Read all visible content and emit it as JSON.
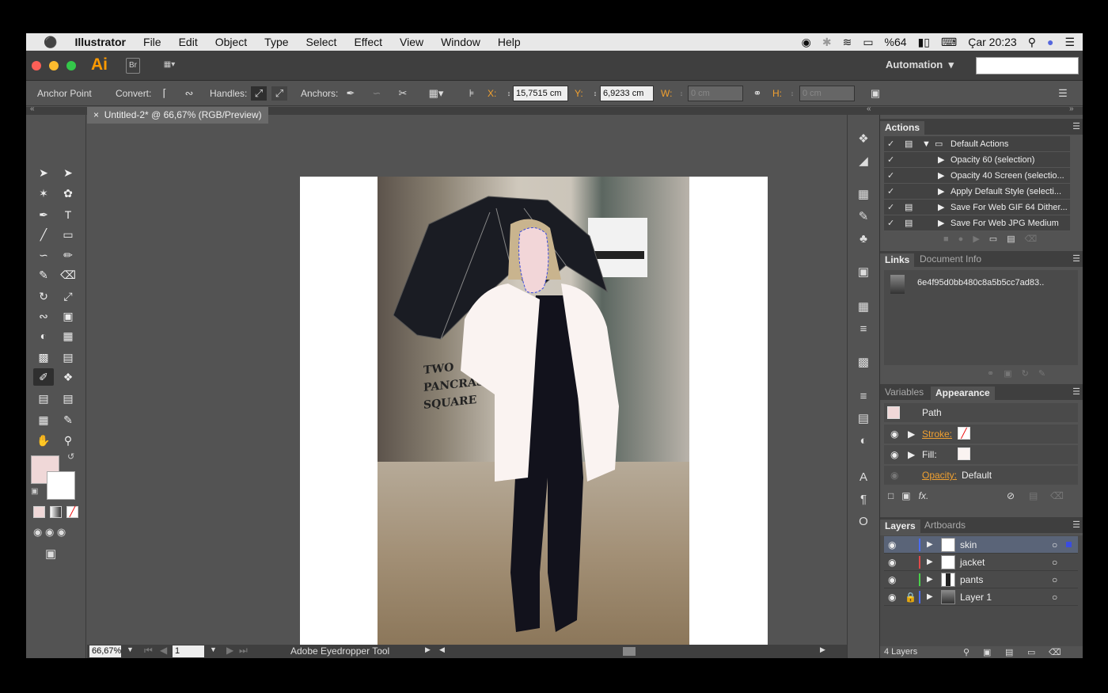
{
  "menubar": {
    "apple": "",
    "app_name": "Illustrator",
    "items": [
      "File",
      "Edit",
      "Object",
      "Type",
      "Select",
      "Effect",
      "View",
      "Window",
      "Help"
    ],
    "battery": "%64",
    "clock": "Çar 20:23"
  },
  "appbar": {
    "logo": "Ai",
    "bridge": "Br",
    "workspace": "Automation",
    "search_value": ""
  },
  "control": {
    "tool_label": "Anchor Point",
    "convert_label": "Convert:",
    "handles_label": "Handles:",
    "anchors_label": "Anchors:",
    "x_label": "X:",
    "x_value": "15,7515 cm",
    "y_label": "Y:",
    "y_value": "6,9233 cm",
    "w_label": "W:",
    "w_value": "0 cm",
    "h_label": "H:",
    "h_value": "0 cm"
  },
  "document": {
    "tab_title": "Untitled-2* @ 66,67% (RGB/Preview)",
    "photo_text": [
      "TWO",
      "PANCRAS",
      "SQUARE"
    ]
  },
  "status": {
    "zoom": "66,67%",
    "artboard": "1",
    "tool_name": "Adobe Eyedropper Tool"
  },
  "actions_panel": {
    "title": "Actions",
    "rows": [
      {
        "label": "Default Actions",
        "type": "folder"
      },
      {
        "label": "Opacity 60 (selection)",
        "type": "action"
      },
      {
        "label": "Opacity 40 Screen (selectio...",
        "type": "action"
      },
      {
        "label": "Apply Default Style (selecti...",
        "type": "action"
      },
      {
        "label": "Save For Web GIF 64 Dither...",
        "type": "action"
      },
      {
        "label": "Save For Web JPG Medium",
        "type": "action"
      }
    ]
  },
  "links_panel": {
    "tab1": "Links",
    "tab2": "Document Info",
    "file": "6e4f95d0bb480c8a5b5cc7ad83.."
  },
  "appearance_panel": {
    "tab1": "Variables",
    "tab2": "Appearance",
    "object": "Path",
    "stroke_label": "Stroke:",
    "fill_label": "Fill:",
    "opacity_label": "Opacity:",
    "opacity_value": "Default",
    "fx": "fx."
  },
  "layers_panel": {
    "tab1": "Layers",
    "tab2": "Artboards",
    "layers": [
      {
        "name": "skin",
        "color": "#4a6cf7"
      },
      {
        "name": "jacket",
        "color": "#e04a4a"
      },
      {
        "name": "pants",
        "color": "#4ad04a"
      },
      {
        "name": "Layer 1",
        "color": "#4a6cf7"
      }
    ],
    "count": "4 Layers"
  },
  "colors": {
    "fill_swatch": "#f0d8d8",
    "accent": "#ff9a00"
  }
}
